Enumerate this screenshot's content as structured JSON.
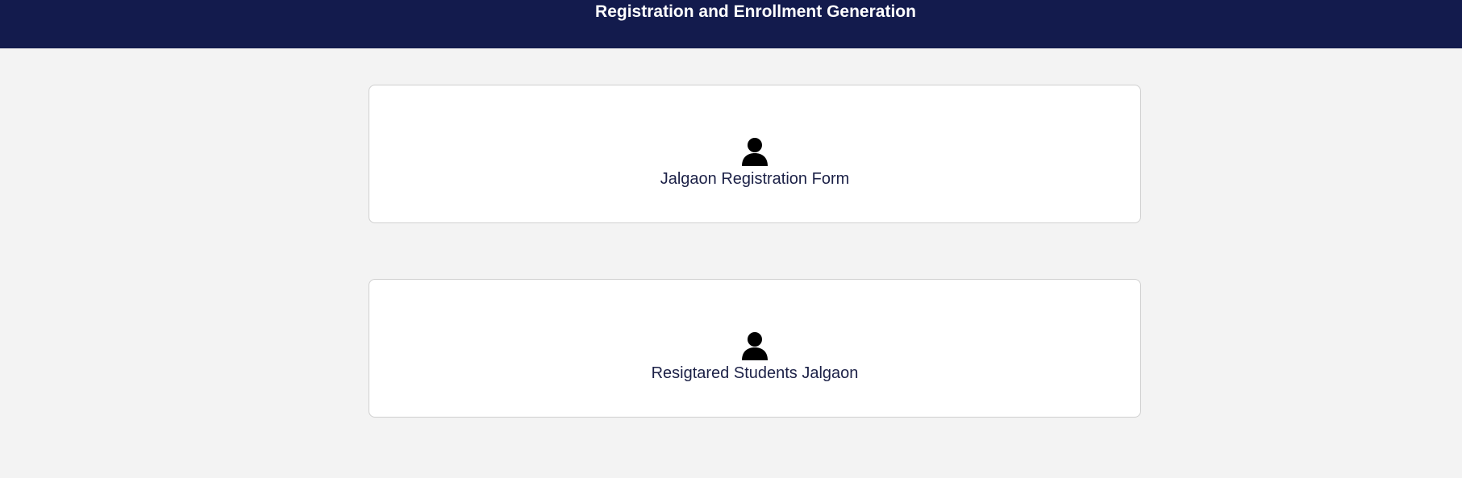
{
  "header": {
    "title": "Registration and Enrollment Generation",
    "background_color": "#131b4d"
  },
  "cards": [
    {
      "label": "Jalgaon Registration Form",
      "icon": "user-icon"
    },
    {
      "label": "Resigtared Students Jalgaon",
      "icon": "user-icon"
    }
  ],
  "colors": {
    "page_background": "#f3f3f3",
    "card_background": "#ffffff",
    "label_text": "#1c2147"
  }
}
